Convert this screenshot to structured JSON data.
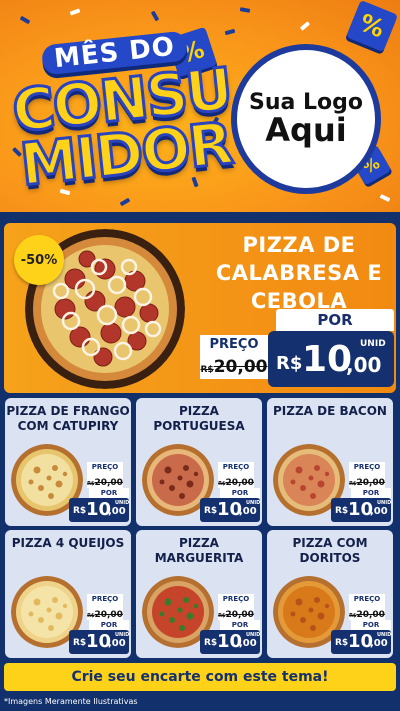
{
  "header": {
    "title_top": "MÊS DO",
    "title_line1": "CONSU",
    "title_line2": "MIDOR",
    "badge_symbol": "%",
    "logo_line1": "Sua Logo",
    "logo_line2": "Aqui"
  },
  "featured": {
    "discount": "-50%",
    "name_lines": [
      "PIZZA DE",
      "CALABRESA E",
      "CEBOLA"
    ],
    "por_label": "POR",
    "preco_label": "PREÇO",
    "old_currency": "R$",
    "old_value": "20,00",
    "new_currency": "R$",
    "new_int": "10",
    "new_dec": ",00",
    "unid_label": "UNID"
  },
  "cards": [
    {
      "title_lines": [
        "PIZZA DE FRANGO",
        "COM CATUPIRY"
      ],
      "preco_label": "PREÇO",
      "old_currency": "R$",
      "old_value": "20,00",
      "por_label": "POR",
      "unid_label": "UNID",
      "currency": "R$",
      "price_int": "10",
      "price_dec": ",00"
    },
    {
      "title_lines": [
        "PIZZA",
        "PORTUGUESA"
      ],
      "preco_label": "PREÇO",
      "old_currency": "R$",
      "old_value": "20,00",
      "por_label": "POR",
      "unid_label": "UNID",
      "currency": "R$",
      "price_int": "10",
      "price_dec": ",00"
    },
    {
      "title_lines": [
        "PIZZA DE BACON",
        ""
      ],
      "preco_label": "PREÇO",
      "old_currency": "R$",
      "old_value": "20,00",
      "por_label": "POR",
      "unid_label": "UNID",
      "currency": "R$",
      "price_int": "10",
      "price_dec": ",00"
    },
    {
      "title_lines": [
        "PIZZA 4 QUEIJOS",
        ""
      ],
      "preco_label": "PREÇO",
      "old_currency": "R$",
      "old_value": "20,00",
      "por_label": "POR",
      "unid_label": "UNID",
      "currency": "R$",
      "price_int": "10",
      "price_dec": ",00"
    },
    {
      "title_lines": [
        "PIZZA",
        "MARGUERITA"
      ],
      "preco_label": "PREÇO",
      "old_currency": "R$",
      "old_value": "20,00",
      "por_label": "POR",
      "unid_label": "UNID",
      "currency": "R$",
      "price_int": "10",
      "price_dec": ",00"
    },
    {
      "title_lines": [
        "PIZZA COM",
        "DORITOS"
      ],
      "preco_label": "PREÇO",
      "old_currency": "R$",
      "old_value": "20,00",
      "por_label": "POR",
      "unid_label": "UNID",
      "currency": "R$",
      "price_int": "10",
      "price_dec": ",00"
    }
  ],
  "footer": {
    "cta": "Crie seu encarte com este tema!",
    "note": "*Imagens Meramente Ilustrativas"
  },
  "colors": {
    "orange": "#f59a1a",
    "navy": "#14306e",
    "yellow": "#ffd21a",
    "card_bg": "#dbe3f3"
  }
}
